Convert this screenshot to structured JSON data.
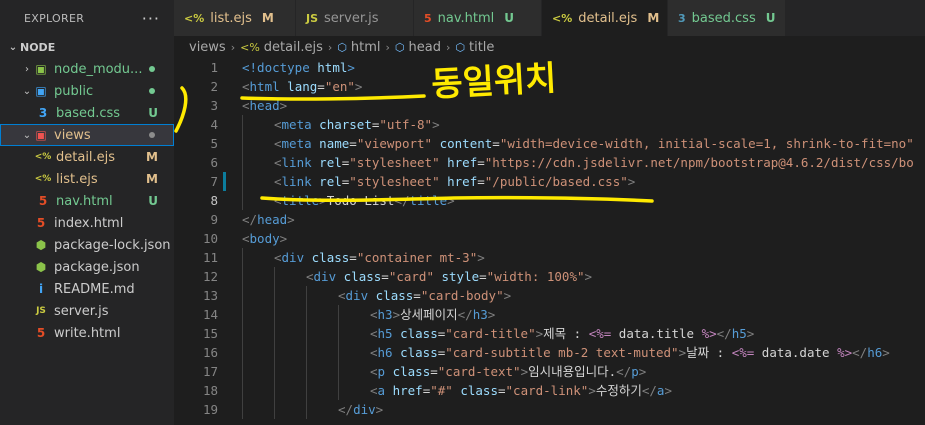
{
  "explorer": {
    "title": "EXPLORER",
    "more_icon": "···",
    "root": "NODE",
    "items": [
      {
        "label": "node_modu...",
        "kind": "folder-node",
        "depth": 1,
        "chevron": "›",
        "badge": "",
        "dot": "#73c991",
        "label_color": "#73c991"
      },
      {
        "label": "public",
        "kind": "folder-public",
        "depth": 1,
        "chevron": "⌄",
        "badge": "",
        "dot": "#73c991",
        "label_color": "#73c991"
      },
      {
        "label": "based.css",
        "kind": "css",
        "depth": 2,
        "chevron": "",
        "badge": "U",
        "badge_color": "#73c991",
        "label_color": "#73c991"
      },
      {
        "label": "views",
        "kind": "folder-views",
        "depth": 1,
        "chevron": "⌄",
        "badge": "",
        "dot": "#8c8c8c",
        "label_color": "#e2c08d",
        "selected": true
      },
      {
        "label": "detail.ejs",
        "kind": "ejs",
        "depth": 2,
        "chevron": "",
        "badge": "M",
        "badge_color": "#e2c08d",
        "label_color": "#e2c08d"
      },
      {
        "label": "list.ejs",
        "kind": "ejs",
        "depth": 2,
        "chevron": "",
        "badge": "M",
        "badge_color": "#e2c08d",
        "label_color": "#e2c08d"
      },
      {
        "label": "nav.html",
        "kind": "html",
        "depth": 2,
        "chevron": "",
        "badge": "U",
        "badge_color": "#73c991",
        "label_color": "#73c991"
      },
      {
        "label": "index.html",
        "kind": "html",
        "depth": 1,
        "chevron": "",
        "badge": "",
        "label_color": "#cccccc"
      },
      {
        "label": "package-lock.json",
        "kind": "node-json",
        "depth": 1,
        "chevron": "",
        "badge": "",
        "label_color": "#cccccc"
      },
      {
        "label": "package.json",
        "kind": "node-json",
        "depth": 1,
        "chevron": "",
        "badge": "",
        "label_color": "#cccccc"
      },
      {
        "label": "README.md",
        "kind": "info",
        "depth": 1,
        "chevron": "",
        "badge": "",
        "label_color": "#cccccc"
      },
      {
        "label": "server.js",
        "kind": "js",
        "depth": 1,
        "chevron": "",
        "badge": "",
        "label_color": "#cccccc"
      },
      {
        "label": "write.html",
        "kind": "html",
        "depth": 1,
        "chevron": "",
        "badge": "",
        "label_color": "#cccccc"
      }
    ]
  },
  "tabs": [
    {
      "label": "list.ejs",
      "icon_text": "<%",
      "icon_color": "#cbcb41",
      "badge": "M",
      "badge_color": "#e2c08d",
      "label_color": "#e2c08d"
    },
    {
      "label": "server.js",
      "icon_text": "JS",
      "icon_color": "#cbcb41",
      "badge": "",
      "label_color": "#969696"
    },
    {
      "label": "nav.html",
      "icon_text": "5",
      "icon_color": "#e44d26",
      "badge": "U",
      "badge_color": "#73c991",
      "label_color": "#73c991"
    },
    {
      "label": "detail.ejs",
      "icon_text": "<%",
      "icon_color": "#cbcb41",
      "badge": "M",
      "badge_color": "#e2c08d",
      "label_color": "#e2c08d",
      "active": true,
      "close": "×"
    },
    {
      "label": "based.css",
      "icon_text": "3",
      "icon_color": "#519aba",
      "badge": "U",
      "badge_color": "#73c991",
      "label_color": "#73c991"
    }
  ],
  "breadcrumbs": [
    {
      "label": "views",
      "icon": ""
    },
    {
      "label": "detail.ejs",
      "icon": "<%"
    },
    {
      "label": "html",
      "icon": "⬡"
    },
    {
      "label": "head",
      "icon": "⬡"
    },
    {
      "label": "title",
      "icon": "⬡"
    }
  ],
  "current_line": 8,
  "modified_line": 7,
  "code_lines": [
    {
      "n": 1,
      "indent": 0,
      "tokens": [
        [
          "tag",
          "<!doctype "
        ],
        [
          "attr",
          "html"
        ],
        [
          "tag",
          ">"
        ]
      ]
    },
    {
      "n": 2,
      "indent": 0,
      "tokens": [
        [
          "br",
          "<"
        ],
        [
          "tag",
          "html "
        ],
        [
          "attr",
          "lang"
        ],
        [
          "text",
          "="
        ],
        [
          "str",
          "\"en\""
        ],
        [
          "br",
          ">"
        ]
      ]
    },
    {
      "n": 3,
      "indent": 0,
      "tokens": [
        [
          "br",
          "<"
        ],
        [
          "tag",
          "head"
        ],
        [
          "br",
          ">"
        ]
      ]
    },
    {
      "n": 4,
      "indent": 1,
      "tokens": [
        [
          "br",
          "<"
        ],
        [
          "tag",
          "meta "
        ],
        [
          "attr",
          "charset"
        ],
        [
          "text",
          "="
        ],
        [
          "str",
          "\"utf-8\""
        ],
        [
          "br",
          ">"
        ]
      ]
    },
    {
      "n": 5,
      "indent": 1,
      "tokens": [
        [
          "br",
          "<"
        ],
        [
          "tag",
          "meta "
        ],
        [
          "attr",
          "name"
        ],
        [
          "text",
          "="
        ],
        [
          "str",
          "\"viewport\" "
        ],
        [
          "attr",
          "content"
        ],
        [
          "text",
          "="
        ],
        [
          "str",
          "\"width=device-width, initial-scale=1, shrink-to-fit=no\""
        ]
      ]
    },
    {
      "n": 6,
      "indent": 1,
      "tokens": [
        [
          "br",
          "<"
        ],
        [
          "tag",
          "link "
        ],
        [
          "attr",
          "rel"
        ],
        [
          "text",
          "="
        ],
        [
          "str",
          "\"stylesheet\" "
        ],
        [
          "attr",
          "href"
        ],
        [
          "text",
          "="
        ],
        [
          "str",
          "\"https://cdn.jsdelivr.net/npm/bootstrap@4.6.2/dist/css/bo"
        ]
      ]
    },
    {
      "n": 7,
      "indent": 1,
      "tokens": [
        [
          "br",
          "<"
        ],
        [
          "tag",
          "link "
        ],
        [
          "attr",
          "rel"
        ],
        [
          "text",
          "="
        ],
        [
          "str",
          "\"stylesheet\" "
        ],
        [
          "attr",
          "href"
        ],
        [
          "text",
          "="
        ],
        [
          "str",
          "\"/public/based.css\""
        ],
        [
          "br",
          ">"
        ]
      ]
    },
    {
      "n": 8,
      "indent": 1,
      "tokens": [
        [
          "br",
          "<"
        ],
        [
          "tag",
          "title"
        ],
        [
          "br",
          ">"
        ],
        [
          "text",
          "Todo List"
        ],
        [
          "br",
          "</"
        ],
        [
          "tag",
          "title"
        ],
        [
          "br",
          ">"
        ]
      ]
    },
    {
      "n": 9,
      "indent": 0,
      "tokens": [
        [
          "br",
          "</"
        ],
        [
          "tag",
          "head"
        ],
        [
          "br",
          ">"
        ]
      ]
    },
    {
      "n": 10,
      "indent": 0,
      "tokens": [
        [
          "br",
          "<"
        ],
        [
          "tag",
          "body"
        ],
        [
          "br",
          ">"
        ]
      ]
    },
    {
      "n": 11,
      "indent": 1,
      "tokens": [
        [
          "br",
          "<"
        ],
        [
          "tag",
          "div "
        ],
        [
          "attr",
          "class"
        ],
        [
          "text",
          "="
        ],
        [
          "str",
          "\"container mt-3\""
        ],
        [
          "br",
          ">"
        ]
      ]
    },
    {
      "n": 12,
      "indent": 2,
      "tokens": [
        [
          "br",
          "<"
        ],
        [
          "tag",
          "div "
        ],
        [
          "attr",
          "class"
        ],
        [
          "text",
          "="
        ],
        [
          "str",
          "\"card\" "
        ],
        [
          "attr",
          "style"
        ],
        [
          "text",
          "="
        ],
        [
          "str",
          "\"width: 100%\""
        ],
        [
          "br",
          ">"
        ]
      ]
    },
    {
      "n": 13,
      "indent": 3,
      "tokens": [
        [
          "br",
          "<"
        ],
        [
          "tag",
          "div "
        ],
        [
          "attr",
          "class"
        ],
        [
          "text",
          "="
        ],
        [
          "str",
          "\"card-body\""
        ],
        [
          "br",
          ">"
        ]
      ]
    },
    {
      "n": 14,
      "indent": 4,
      "tokens": [
        [
          "br",
          "<"
        ],
        [
          "tag",
          "h3"
        ],
        [
          "br",
          ">"
        ],
        [
          "text",
          "상세페이지"
        ],
        [
          "br",
          "</"
        ],
        [
          "tag",
          "h3"
        ],
        [
          "br",
          ">"
        ]
      ]
    },
    {
      "n": 15,
      "indent": 4,
      "tokens": [
        [
          "br",
          "<"
        ],
        [
          "tag",
          "h5 "
        ],
        [
          "attr",
          "class"
        ],
        [
          "text",
          "="
        ],
        [
          "str",
          "\"card-title\""
        ],
        [
          "br",
          ">"
        ],
        [
          "text",
          "제목 : "
        ],
        [
          "ejs",
          "<%="
        ],
        [
          "text",
          " data.title "
        ],
        [
          "ejs",
          "%>"
        ],
        [
          "br",
          "</"
        ],
        [
          "tag",
          "h5"
        ],
        [
          "br",
          ">"
        ]
      ]
    },
    {
      "n": 16,
      "indent": 4,
      "tokens": [
        [
          "br",
          "<"
        ],
        [
          "tag",
          "h6 "
        ],
        [
          "attr",
          "class"
        ],
        [
          "text",
          "="
        ],
        [
          "str",
          "\"card-subtitle mb-2 text-muted\""
        ],
        [
          "br",
          ">"
        ],
        [
          "text",
          "날짜 : "
        ],
        [
          "ejs",
          "<%="
        ],
        [
          "text",
          " data.date "
        ],
        [
          "ejs",
          "%>"
        ],
        [
          "br",
          "</"
        ],
        [
          "tag",
          "h6"
        ],
        [
          "br",
          ">"
        ]
      ]
    },
    {
      "n": 17,
      "indent": 4,
      "tokens": [
        [
          "br",
          "<"
        ],
        [
          "tag",
          "p "
        ],
        [
          "attr",
          "class"
        ],
        [
          "text",
          "="
        ],
        [
          "str",
          "\"card-text\""
        ],
        [
          "br",
          ">"
        ],
        [
          "text",
          "임시내용입니다."
        ],
        [
          "br",
          "</"
        ],
        [
          "tag",
          "p"
        ],
        [
          "br",
          ">"
        ]
      ]
    },
    {
      "n": 18,
      "indent": 4,
      "tokens": [
        [
          "br",
          "<"
        ],
        [
          "tag",
          "a "
        ],
        [
          "attr",
          "href"
        ],
        [
          "text",
          "="
        ],
        [
          "str",
          "\"#\" "
        ],
        [
          "attr",
          "class"
        ],
        [
          "text",
          "="
        ],
        [
          "str",
          "\"card-link\""
        ],
        [
          "br",
          ">"
        ],
        [
          "text",
          "수정하기"
        ],
        [
          "br",
          "</"
        ],
        [
          "tag",
          "a"
        ],
        [
          "br",
          ">"
        ]
      ]
    },
    {
      "n": 19,
      "indent": 3,
      "tokens": [
        [
          "br",
          "</"
        ],
        [
          "tag",
          "div"
        ],
        [
          "br",
          ">"
        ]
      ]
    }
  ],
  "annotation": {
    "text": "동일위치",
    "color": "#ffea00"
  }
}
